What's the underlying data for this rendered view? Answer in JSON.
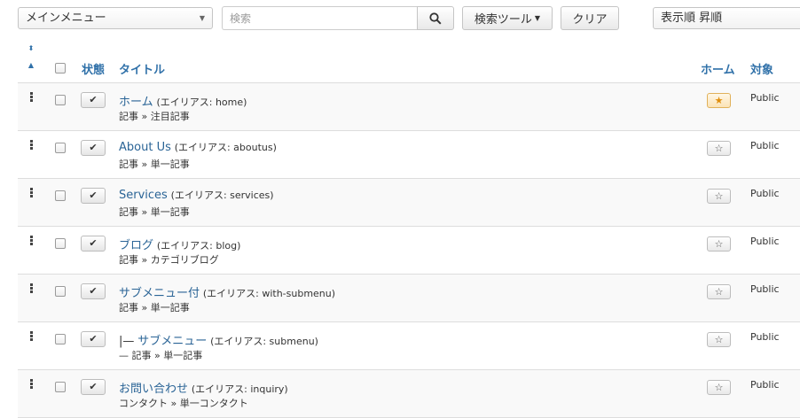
{
  "toolbar": {
    "menu_select": "メインメニュー",
    "search_placeholder": "検索",
    "search_tools_label": "検索ツール",
    "clear_label": "クリア",
    "ordering_select": "表示順 昇順"
  },
  "columns": {
    "status": "状態",
    "title": "タイトル",
    "home": "ホーム",
    "access": "対象"
  },
  "rows": [
    {
      "prefix": "",
      "title": "ホーム",
      "alias": "(エイリアス: home)",
      "type": "記事 » 注目記事",
      "home": true,
      "access": "Public"
    },
    {
      "prefix": "",
      "title": "About Us",
      "alias": "(エイリアス: aboutus)",
      "type": "記事 » 単一記事",
      "home": false,
      "access": "Public"
    },
    {
      "prefix": "",
      "title": "Services",
      "alias": "(エイリアス: services)",
      "type": "記事 » 単一記事",
      "home": false,
      "access": "Public"
    },
    {
      "prefix": "",
      "title": "ブログ",
      "alias": "(エイリアス: blog)",
      "type": "記事 » カテゴリブログ",
      "home": false,
      "access": "Public"
    },
    {
      "prefix": "",
      "title": "サブメニュー付",
      "alias": "(エイリアス: with-submenu)",
      "type": "記事 » 単一記事",
      "home": false,
      "access": "Public"
    },
    {
      "prefix": "|—",
      "title": "サブメニュー",
      "alias": "(エイリアス: submenu)",
      "type": "— 記事 » 単一記事",
      "home": false,
      "access": "Public"
    },
    {
      "prefix": "",
      "title": "お問い合わせ",
      "alias": "(エイリアス: inquiry)",
      "type": "コンタクト » 単一コンタクト",
      "home": false,
      "access": "Public"
    }
  ]
}
